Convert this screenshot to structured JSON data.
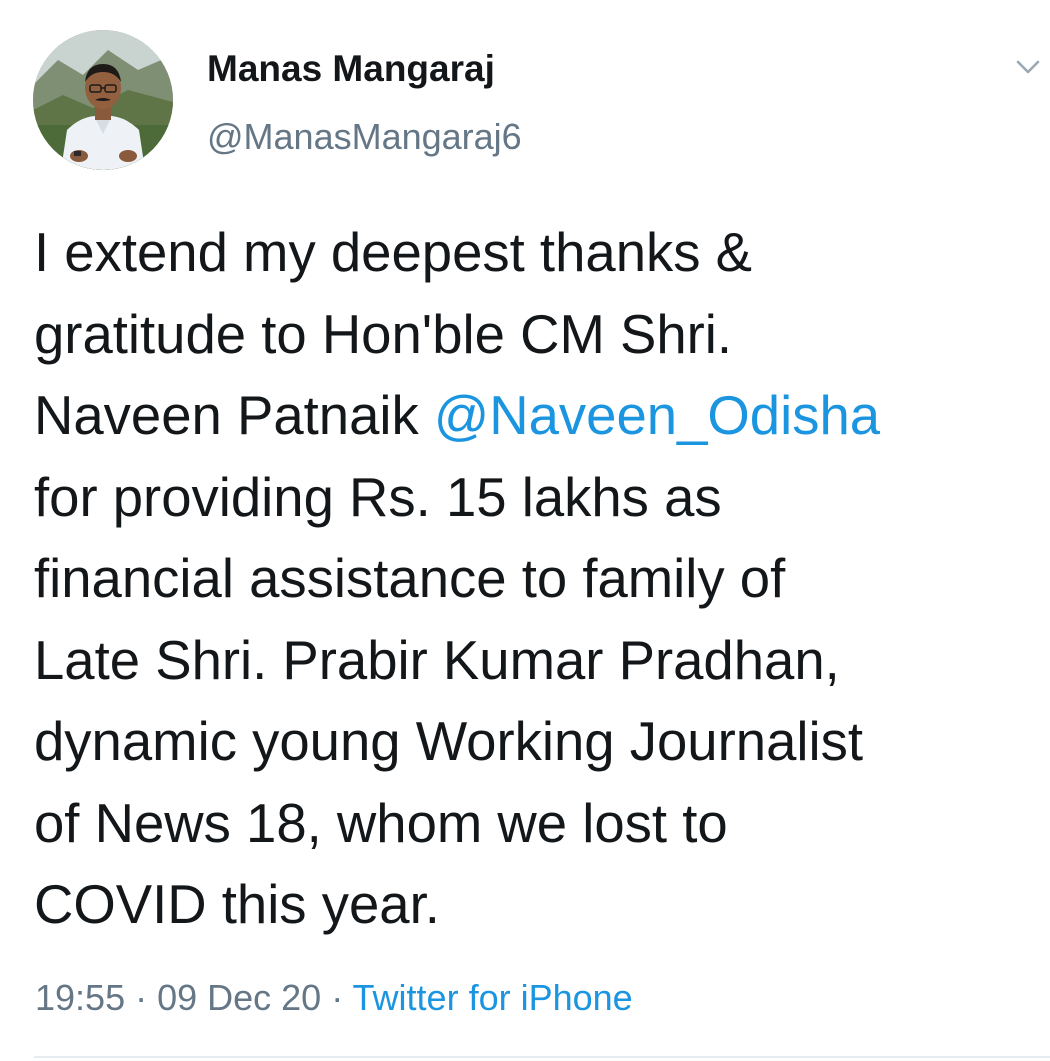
{
  "author": {
    "display_name": "Manas Mangaraj",
    "handle": "@ManasMangaraj6",
    "avatar_icon": "profile-photo"
  },
  "menu": {
    "icon": "chevron-down-icon"
  },
  "tweet": {
    "line1": "I extend my deepest thanks &",
    "line2": "gratitude to Hon'ble CM Shri.",
    "line3_prefix": "Naveen Patnaik ",
    "mention": "@Naveen_Odisha",
    "line4": "for providing Rs. 15 lakhs as",
    "line5": "financial assistance to family of",
    "line6": "Late Shri. Prabir Kumar Pradhan,",
    "line7": "dynamic young Working Journalist",
    "line8": "of News 18, whom we lost to",
    "line9": "COVID this year."
  },
  "meta": {
    "time": "19:55",
    "separator": " · ",
    "date": "09 Dec 20",
    "source": "Twitter for iPhone"
  },
  "colors": {
    "link": "#1b95e0",
    "secondary_text": "#657786",
    "primary_text": "#14171a"
  }
}
